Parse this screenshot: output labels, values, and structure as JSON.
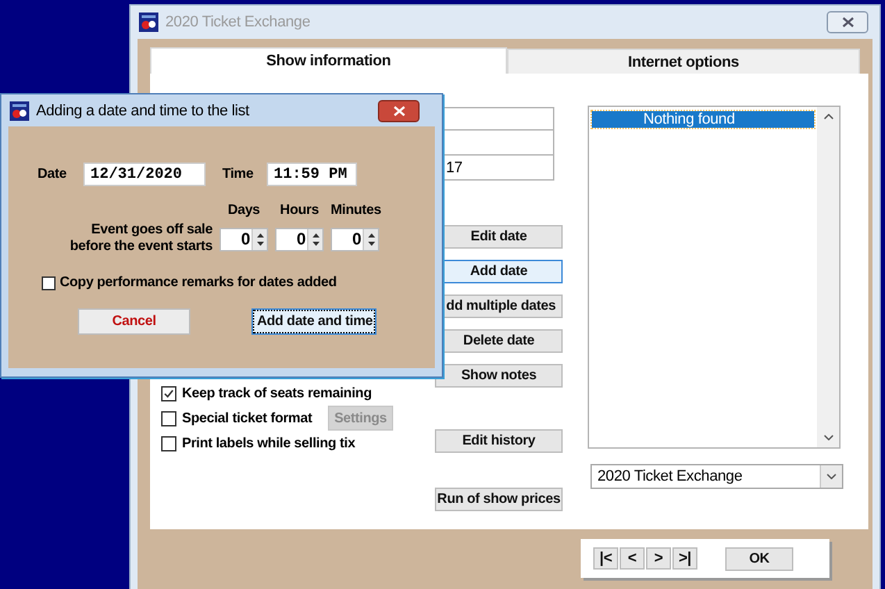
{
  "main_window": {
    "title": "2020 Ticket Exchange",
    "active": false,
    "tabs": [
      {
        "label": "Show information",
        "selected": true
      },
      {
        "label": "Internet options",
        "selected": false
      }
    ],
    "fields": [
      {
        "kind": "text"
      },
      {
        "kind": "text"
      },
      {
        "kind": "text",
        "value": "17"
      }
    ],
    "button_groups": [
      [
        {
          "label": "Edit date",
          "focused": false
        },
        {
          "label": "Add date",
          "focused": true
        },
        {
          "label": "dd multiple dates",
          "focused": false
        },
        {
          "label": "Delete date",
          "focused": false
        },
        {
          "label": "Show notes",
          "focused": false
        }
      ],
      [
        {
          "label": "Edit history",
          "focused": false
        }
      ],
      [
        {
          "label": "Run of show prices",
          "focused": false
        }
      ]
    ],
    "options": [
      {
        "label": "Keep track of seats remaining",
        "checked": true
      },
      {
        "label": "Special ticket format",
        "checked": false,
        "button": {
          "label": "Settings",
          "disabled": true
        }
      },
      {
        "label": "Print labels while selling tix",
        "checked": false
      }
    ],
    "list": {
      "items": [
        {
          "text": "Nothing found",
          "selected": true
        }
      ]
    },
    "dropdown": {
      "value": "2020 Ticket Exchange"
    },
    "nav": {
      "buttons": [
        "|<",
        "<",
        ">",
        ">|"
      ],
      "ok": "OK"
    }
  },
  "dialog": {
    "title": "Adding a date and time to the list",
    "active": true,
    "date_label": "Date",
    "date": "12/31/2020",
    "time_label": "Time",
    "time": "11:59 PM",
    "offsale_label": "Event goes off sale before the event starts",
    "spinners": [
      {
        "label": "Days",
        "value": "0"
      },
      {
        "label": "Hours",
        "value": "0"
      },
      {
        "label": "Minutes",
        "value": "0"
      }
    ],
    "copy_remarks": {
      "label": "Copy performance remarks for dates added",
      "checked": false
    },
    "buttons": [
      {
        "label": "Cancel",
        "kind": "cancel",
        "focused": false
      },
      {
        "label": "Add date and time",
        "kind": "default",
        "focused": true
      }
    ]
  }
}
